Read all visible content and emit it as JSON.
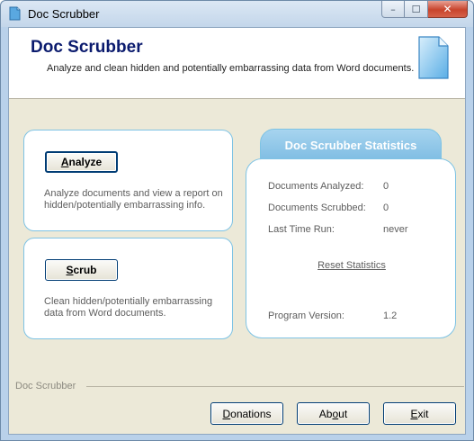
{
  "window": {
    "title": "Doc Scrubber",
    "minimize_glyph": "–",
    "maximize_glyph": "☐",
    "close_glyph": "✕"
  },
  "header": {
    "title": "Doc Scrubber",
    "subtitle": "Analyze and clean hidden and potentially embarrassing data from Word documents.",
    "icon": "document-icon"
  },
  "analyze": {
    "mnemonic": "A",
    "label_rest": "nalyze",
    "description": "Analyze documents and view a report on hidden/potentially embarrassing info."
  },
  "scrub": {
    "mnemonic": "S",
    "label_rest": "crub",
    "description": "Clean hidden/potentially embarrassing data from Word documents."
  },
  "stats": {
    "title": "Doc Scrubber Statistics",
    "rows": [
      {
        "label": "Documents Analyzed:",
        "value": "0"
      },
      {
        "label": "Documents Scrubbed:",
        "value": "0"
      },
      {
        "label": "Last Time Run:",
        "value": "never"
      }
    ],
    "reset_label": "Reset Statistics",
    "version_label": "Program Version:",
    "version_value": "1.2"
  },
  "footer": {
    "group_label": "Doc Scrubber",
    "donations_mnemonic": "D",
    "donations_rest": "onations",
    "about_pre": "Ab",
    "about_mnemonic": "o",
    "about_post": "ut",
    "exit_mnemonic": "E",
    "exit_rest": "xit"
  },
  "colors": {
    "header_title": "#0b1b6e",
    "panel_border": "#7ec3e4",
    "stats_tab": "#8cc6e8"
  }
}
